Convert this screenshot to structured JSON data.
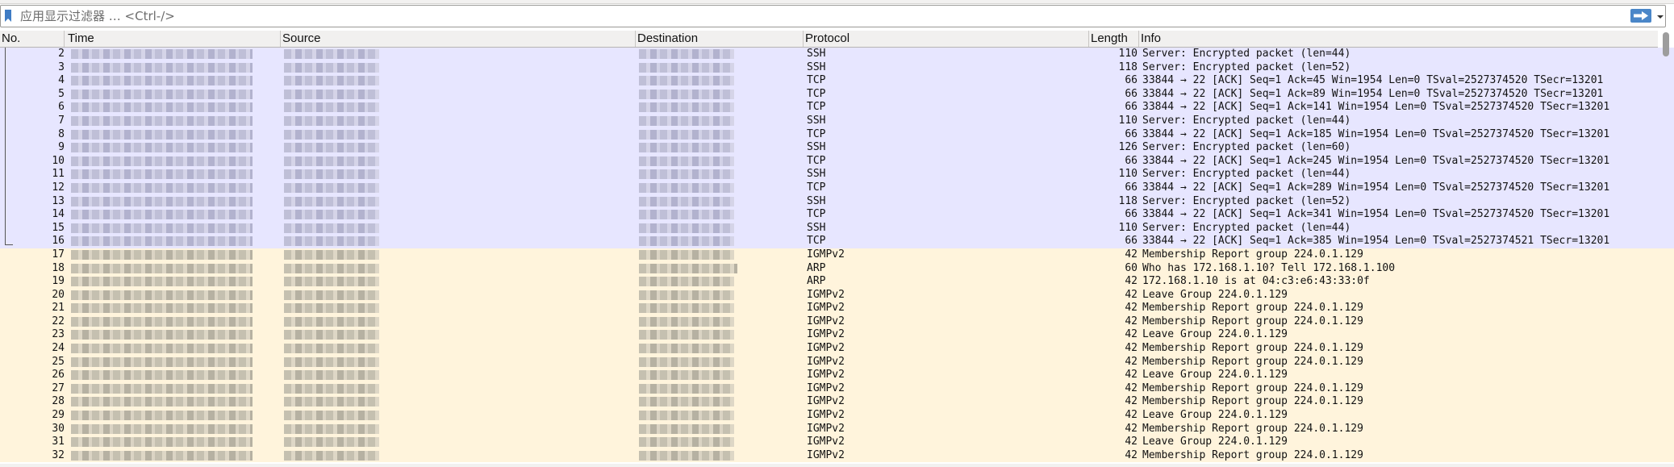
{
  "filter": {
    "placeholder": "应用显示过滤器 … <Ctrl-/>",
    "value": ""
  },
  "columns": {
    "no": "No.",
    "time": "Time",
    "source": "Source",
    "destination": "Destination",
    "protocol": "Protocol",
    "length": "Length",
    "info": "Info"
  },
  "colors": {
    "tcp_row": "#e7e6ff",
    "udp_row": "#fff4dc"
  },
  "packets": [
    {
      "no": "2",
      "protocol": "SSH",
      "length": "110",
      "info": "Server: Encrypted packet (len=44)",
      "color": "tcp"
    },
    {
      "no": "3",
      "protocol": "SSH",
      "length": "118",
      "info": "Server: Encrypted packet (len=52)",
      "color": "tcp"
    },
    {
      "no": "4",
      "protocol": "TCP",
      "length": "66",
      "info": "33844 → 22 [ACK] Seq=1 Ack=45 Win=1954 Len=0 TSval=2527374520 TSecr=13201",
      "color": "tcp"
    },
    {
      "no": "5",
      "protocol": "TCP",
      "length": "66",
      "info": "33844 → 22 [ACK] Seq=1 Ack=89 Win=1954 Len=0 TSval=2527374520 TSecr=13201",
      "color": "tcp"
    },
    {
      "no": "6",
      "protocol": "TCP",
      "length": "66",
      "info": "33844 → 22 [ACK] Seq=1 Ack=141 Win=1954 Len=0 TSval=2527374520 TSecr=13201",
      "color": "tcp"
    },
    {
      "no": "7",
      "protocol": "SSH",
      "length": "110",
      "info": "Server: Encrypted packet (len=44)",
      "color": "tcp"
    },
    {
      "no": "8",
      "protocol": "TCP",
      "length": "66",
      "info": "33844 → 22 [ACK] Seq=1 Ack=185 Win=1954 Len=0 TSval=2527374520 TSecr=13201",
      "color": "tcp"
    },
    {
      "no": "9",
      "protocol": "SSH",
      "length": "126",
      "info": "Server: Encrypted packet (len=60)",
      "color": "tcp"
    },
    {
      "no": "10",
      "protocol": "TCP",
      "length": "66",
      "info": "33844 → 22 [ACK] Seq=1 Ack=245 Win=1954 Len=0 TSval=2527374520 TSecr=13201",
      "color": "tcp"
    },
    {
      "no": "11",
      "protocol": "SSH",
      "length": "110",
      "info": "Server: Encrypted packet (len=44)",
      "color": "tcp"
    },
    {
      "no": "12",
      "protocol": "TCP",
      "length": "66",
      "info": "33844 → 22 [ACK] Seq=1 Ack=289 Win=1954 Len=0 TSval=2527374520 TSecr=13201",
      "color": "tcp"
    },
    {
      "no": "13",
      "protocol": "SSH",
      "length": "118",
      "info": "Server: Encrypted packet (len=52)",
      "color": "tcp"
    },
    {
      "no": "14",
      "protocol": "TCP",
      "length": "66",
      "info": "33844 → 22 [ACK] Seq=1 Ack=341 Win=1954 Len=0 TSval=2527374520 TSecr=13201",
      "color": "tcp"
    },
    {
      "no": "15",
      "protocol": "SSH",
      "length": "110",
      "info": "Server: Encrypted packet (len=44)",
      "color": "tcp"
    },
    {
      "no": "16",
      "protocol": "TCP",
      "length": "66",
      "info": "33844 → 22 [ACK] Seq=1 Ack=385 Win=1954 Len=0 TSval=2527374521 TSecr=13201",
      "color": "tcp"
    },
    {
      "no": "17",
      "protocol": "IGMPv2",
      "length": "42",
      "info": "Membership Report group 224.0.1.129",
      "color": "udp"
    },
    {
      "no": "18",
      "protocol": "ARP",
      "length": "60",
      "info": "Who has 172.168.1.10? Tell 172.168.1.100",
      "color": "udp"
    },
    {
      "no": "19",
      "protocol": "ARP",
      "length": "42",
      "info": "172.168.1.10 is at 04:c3:e6:43:33:0f",
      "color": "udp"
    },
    {
      "no": "20",
      "protocol": "IGMPv2",
      "length": "42",
      "info": "Leave Group 224.0.1.129",
      "color": "udp"
    },
    {
      "no": "21",
      "protocol": "IGMPv2",
      "length": "42",
      "info": "Membership Report group 224.0.1.129",
      "color": "udp"
    },
    {
      "no": "22",
      "protocol": "IGMPv2",
      "length": "42",
      "info": "Membership Report group 224.0.1.129",
      "color": "udp"
    },
    {
      "no": "23",
      "protocol": "IGMPv2",
      "length": "42",
      "info": "Leave Group 224.0.1.129",
      "color": "udp"
    },
    {
      "no": "24",
      "protocol": "IGMPv2",
      "length": "42",
      "info": "Membership Report group 224.0.1.129",
      "color": "udp"
    },
    {
      "no": "25",
      "protocol": "IGMPv2",
      "length": "42",
      "info": "Membership Report group 224.0.1.129",
      "color": "udp"
    },
    {
      "no": "26",
      "protocol": "IGMPv2",
      "length": "42",
      "info": "Leave Group 224.0.1.129",
      "color": "udp"
    },
    {
      "no": "27",
      "protocol": "IGMPv2",
      "length": "42",
      "info": "Membership Report group 224.0.1.129",
      "color": "udp"
    },
    {
      "no": "28",
      "protocol": "IGMPv2",
      "length": "42",
      "info": "Membership Report group 224.0.1.129",
      "color": "udp"
    },
    {
      "no": "29",
      "protocol": "IGMPv2",
      "length": "42",
      "info": "Leave Group 224.0.1.129",
      "color": "udp"
    },
    {
      "no": "30",
      "protocol": "IGMPv2",
      "length": "42",
      "info": "Membership Report group 224.0.1.129",
      "color": "udp"
    },
    {
      "no": "31",
      "protocol": "IGMPv2",
      "length": "42",
      "info": "Leave Group 224.0.1.129",
      "color": "udp"
    },
    {
      "no": "32",
      "protocol": "IGMPv2",
      "length": "42",
      "info": "Membership Report group 224.0.1.129",
      "color": "udp"
    }
  ]
}
